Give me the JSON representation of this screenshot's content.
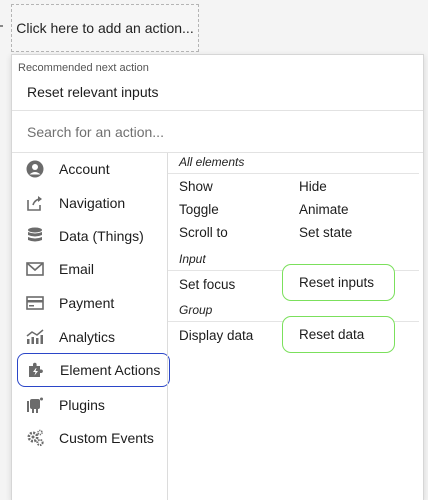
{
  "trigger": {
    "label": "Click here to add an action..."
  },
  "recommended": {
    "label": "Recommended next action",
    "action": "Reset relevant inputs"
  },
  "search": {
    "placeholder": "Search for an action..."
  },
  "categories": [
    {
      "label": "Account",
      "icon": "account-icon"
    },
    {
      "label": "Navigation",
      "icon": "navigation-icon"
    },
    {
      "label": "Data (Things)",
      "icon": "database-icon"
    },
    {
      "label": "Email",
      "icon": "email-icon"
    },
    {
      "label": "Payment",
      "icon": "payment-icon"
    },
    {
      "label": "Analytics",
      "icon": "analytics-icon"
    },
    {
      "label": "Element Actions",
      "icon": "puzzle-icon",
      "active": true
    },
    {
      "label": "Plugins",
      "icon": "plugin-icon"
    },
    {
      "label": "Custom Events",
      "icon": "gears-icon"
    }
  ],
  "sections": {
    "all_elements": {
      "title": "All elements",
      "actions": [
        "Show",
        "Hide",
        "Toggle",
        "Animate",
        "Scroll to",
        "Set state"
      ]
    },
    "input": {
      "title": "Input",
      "actions": [
        "Set focus",
        "Reset inputs"
      ]
    },
    "group": {
      "title": "Group",
      "actions": [
        "Display data",
        "Reset data"
      ]
    }
  },
  "colors": {
    "active_border": "#2b46c8",
    "highlight_border": "#7be05c"
  }
}
